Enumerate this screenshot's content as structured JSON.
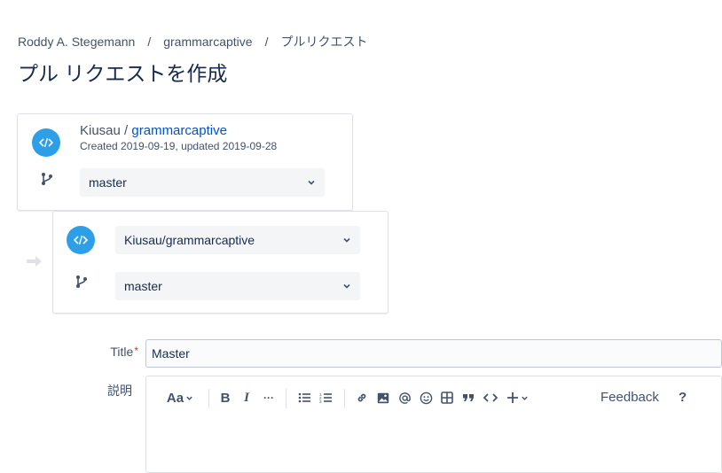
{
  "breadcrumb": {
    "items": [
      "Roddy A. Stegemann",
      "grammarcaptive",
      "プルリクエスト"
    ],
    "separator": "/"
  },
  "page_title": "プル リクエストを作成",
  "source": {
    "owner": "Kiusau",
    "separator": "/",
    "repo": "grammarcaptive",
    "meta": "Created 2019-09-19, updated 2019-09-28",
    "branch": "master"
  },
  "destination": {
    "repo": "Kiusau/grammarcaptive",
    "branch": "master"
  },
  "form": {
    "title_label": "Title",
    "required_mark": "*",
    "title_value": "Master",
    "description_label": "説明"
  },
  "editor": {
    "text_style_label": "Aa",
    "bold_label": "B",
    "italic_label": "I",
    "more_label": "···",
    "feedback_label": "Feedback",
    "help_label": "?"
  },
  "colors": {
    "accent": "#0052cc",
    "repo_icon": "#2d9fe8",
    "required": "#de350b"
  }
}
